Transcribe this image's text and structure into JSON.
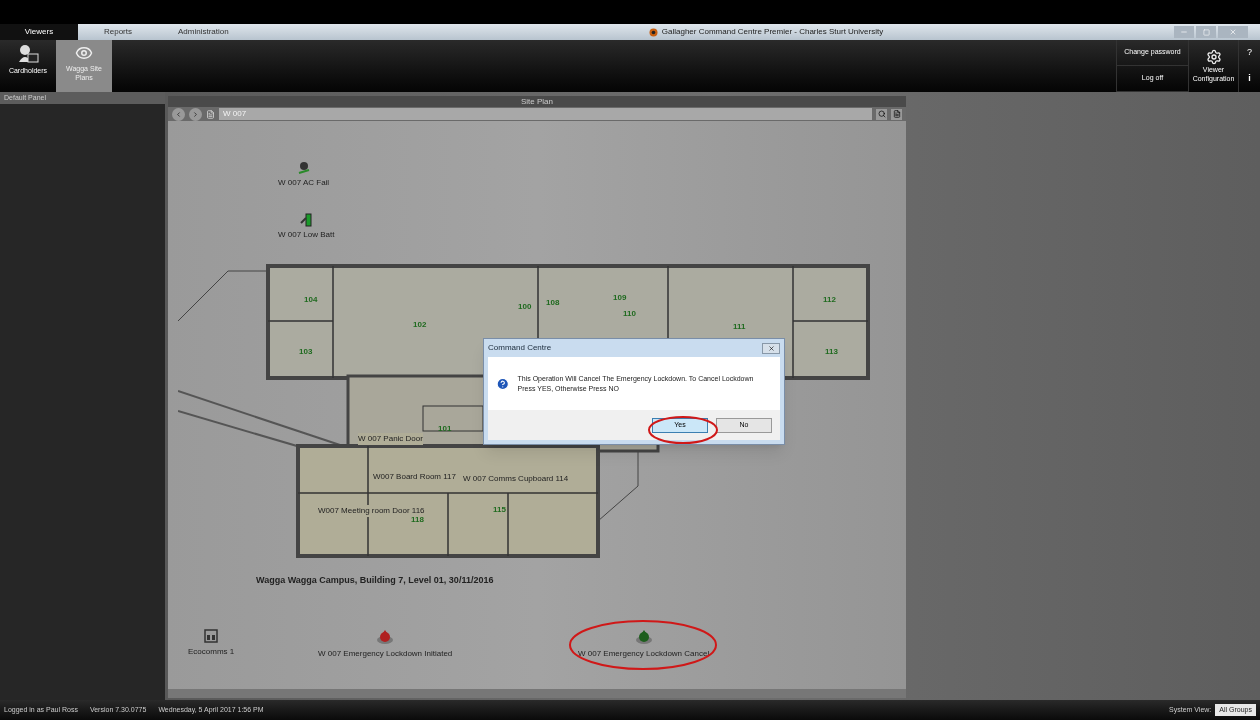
{
  "window": {
    "title": "Gallagher Command Centre Premier - Charles Sturt University"
  },
  "tabs": [
    {
      "label": "Viewers",
      "selected": true
    },
    {
      "label": "Reports",
      "selected": false
    },
    {
      "label": "Administration",
      "selected": false
    }
  ],
  "ribbon": {
    "items": [
      {
        "label": "Cardholders",
        "kind": "cardholders",
        "selected": false
      },
      {
        "label": "Wagga Site Plans",
        "kind": "siteplan",
        "selected": true
      }
    ],
    "account": [
      "Change password",
      "Log off"
    ],
    "viewer_configuration": "Viewer Configuration",
    "help": "?",
    "info": "i"
  },
  "sidebar": {
    "title": "Default Panel"
  },
  "site_plan": {
    "title": "Site Plan",
    "address": "W 007",
    "items": [
      {
        "label": "W 007 AC Fail",
        "kind": "acfail"
      },
      {
        "label": "W 007 Low Batt",
        "kind": "battery"
      }
    ],
    "rooms": [
      "104",
      "102",
      "100",
      "108",
      "109",
      "110",
      "111",
      "112",
      "113",
      "103",
      "101",
      "115",
      "118"
    ],
    "doors": [
      "W 007 Panic Door",
      "W007 Board Room 117",
      "W 007 Comms Cupboard 114",
      "W007 Meeting room Door 116"
    ],
    "caption": "Wagga Wagga Campus, Building 7, Level 01, 30/11/2016",
    "bottom_items": [
      {
        "label": "Ecocomms 1",
        "kind": "panel"
      },
      {
        "label": "W 007 Emergency Lockdown Initiated",
        "kind": "lockdown_red"
      },
      {
        "label": "W 007 Emergency Lockdown Cancel",
        "kind": "lockdown_green"
      }
    ]
  },
  "dialog": {
    "title": "Command Centre",
    "message": "This Operation Will Cancel The Emergency Lockdown. To Cancel Lockdown Press YES, Otherwise Press NO",
    "buttons": [
      {
        "label": "Yes",
        "selected": true
      },
      {
        "label": "No",
        "selected": false
      }
    ]
  },
  "status_bar": {
    "user": "Logged in as Paul Ross",
    "version": "Version 7.30.0775",
    "datetime": "Wednesday, 5 April 2017 1:56 PM",
    "view_label": "System View:",
    "view_value": "All Groups"
  }
}
